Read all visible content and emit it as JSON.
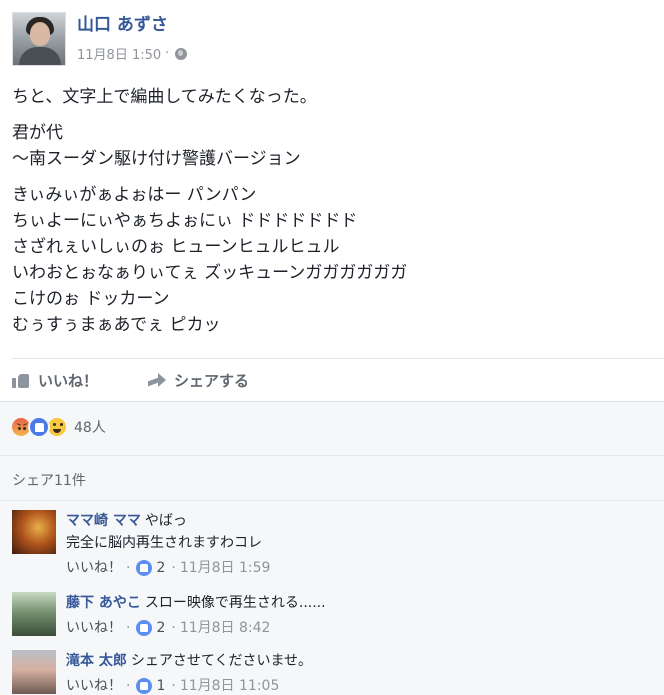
{
  "post": {
    "author": "山口 あずさ",
    "timestamp": "11月8日 1:50",
    "privacy_separator": "·",
    "paragraphs": [
      "ちと、文字上で編曲してみたくなった。",
      "君が代\n〜南スーダン駆け付け警護バージョン",
      "きぃみぃがぁよぉはー パンパン\nちぃよーにぃやぁちよぉにぃ ドドドドドドド\nさざれぇいしぃのぉ ヒューンヒュルヒュル\nいわおとぉなぁりぃてぇ ズッキューンガガガガガガ\nこけのぉ ドッカーン\nむぅすぅまぁあでぇ ピカッ"
    ]
  },
  "actions": {
    "like_label": "いいね！",
    "share_label": "シェアする"
  },
  "reactions": {
    "count": "48人"
  },
  "shares": {
    "label": "シェア11件"
  },
  "comments": [
    {
      "author": "ママ崎 ママ",
      "text": "やばっ",
      "text2": "完全に脳内再生されますわコレ",
      "like_label": "いいね！",
      "sep": "·",
      "like_count": "2",
      "timestamp": "11月8日 1:59"
    },
    {
      "author": "藤下 あやこ",
      "text": "スロー映像で再生される......",
      "like_label": "いいね！",
      "sep": "·",
      "like_count": "2",
      "timestamp": "11月8日 8:42"
    },
    {
      "author": "滝本 太郎",
      "text": "シェアさせてくださいませ。",
      "like_label": "いいね！",
      "sep": "·",
      "like_count": "1",
      "timestamp": "11月8日 11:05"
    }
  ]
}
